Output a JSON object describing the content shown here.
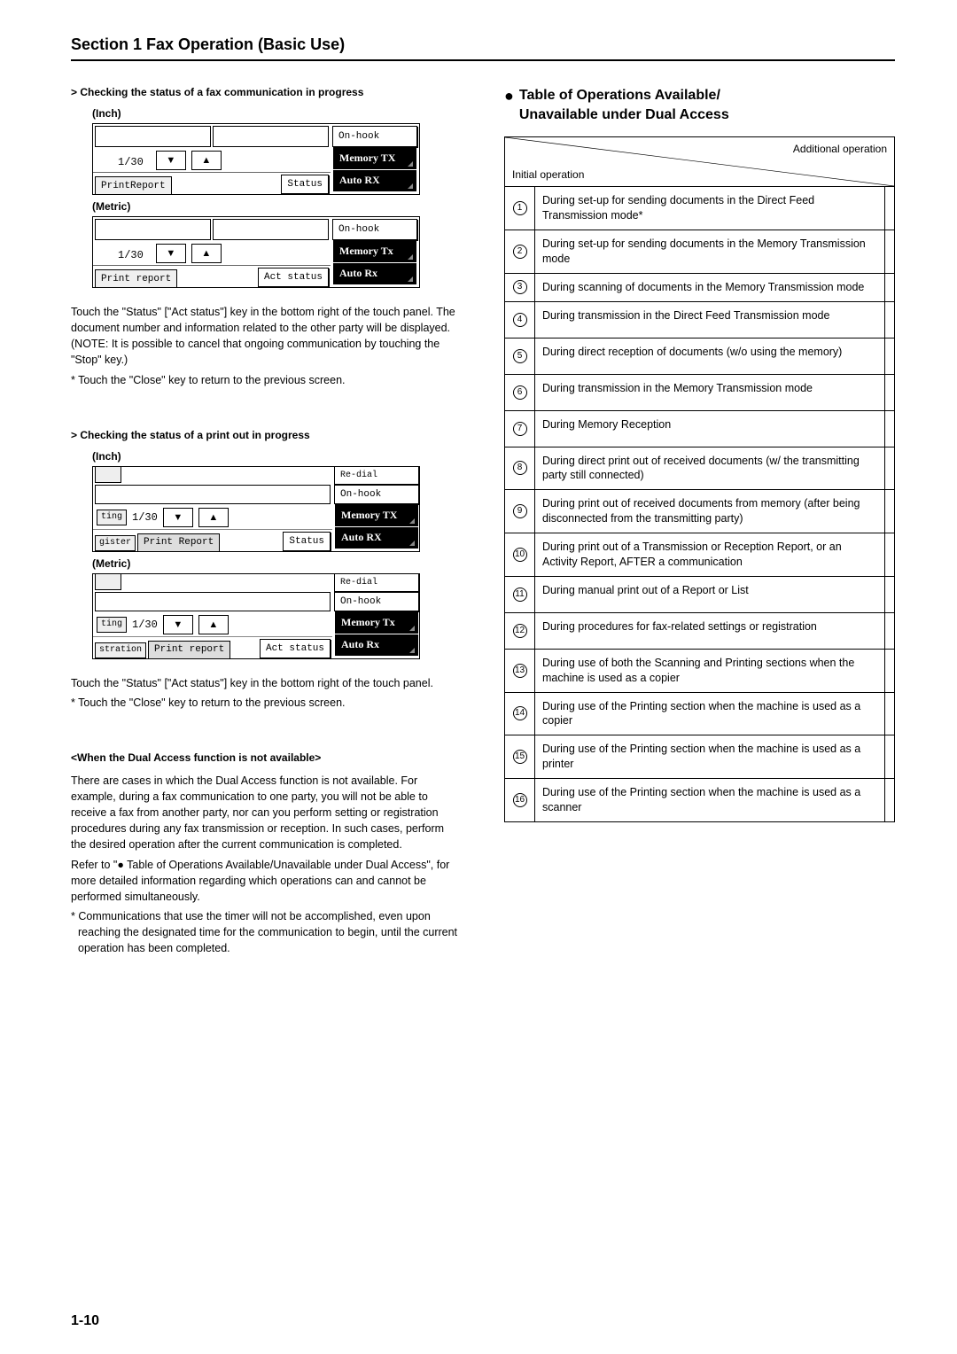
{
  "section_title": "Section 1  Fax Operation (Basic Use)",
  "page_number": "1-10",
  "left": {
    "h1": "> Checking the status of a fax communication in progress",
    "inch_label": "(Inch)",
    "metric_label": "(Metric)",
    "lcd1": {
      "frac": "1/30",
      "btn_onhook": "On-hook",
      "btn_memtx_i": "Memory TX",
      "btn_autorx_i": "Auto RX",
      "btn_memtx_m": "Memory Tx",
      "btn_autorx_m": "Auto Rx",
      "tab_print_i": "PrintReport",
      "tab_status_i": "Status",
      "tab_print_m": "Print report",
      "tab_status_m": "Act status"
    },
    "para1a": "Touch the \"Status\" [\"Act status\"] key in the bottom right of the touch panel. The document number and information related to the other party will be displayed. (NOTE: It is possible to cancel that ongoing communication by touching the \"Stop\" key.)",
    "para1b": "* Touch the \"Close\" key to return to the previous screen.",
    "h2": "> Checking the status of a print out in progress",
    "lcd2": {
      "frac": "1/30",
      "btn_redial": "Re-dial",
      "btn_onhook": "On-hook",
      "tab_ting": "ting",
      "tab_gister": "gister",
      "tab_printreport_i": "Print Report",
      "tab_status_i": "Status",
      "tab_stration": "stration",
      "tab_printreport_m": "Print report",
      "tab_status_m": "Act status"
    },
    "para2a": "Touch the \"Status\" [\"Act status\"] key in the bottom right of the touch panel.",
    "para2b": "* Touch the \"Close\" key to return to the previous screen.",
    "h3": "<When the Dual Access function is not available>",
    "para3a": "There are cases in which the Dual Access function is not available. For example, during a fax communication to one party, you will not be able to receive a fax from another party, nor can you perform setting or registration procedures during any fax transmission or reception. In such cases, perform the desired operation after the current communication is completed.",
    "para3b": "Refer to \"● Table of Operations Available/Unavailable under Dual Access\", for more detailed information regarding which operations can and cannot be performed simultaneously.",
    "para3c": "* Communications that use the timer will not be accomplished, even upon reaching the designated time for the communication to begin, until the current operation has been completed."
  },
  "right": {
    "heading_l1": "Table of Operations Available/",
    "heading_l2": "Unavailable under Dual Access",
    "additional_op": "Additional operation",
    "initial_op": "Initial operation",
    "rows": [
      "During set-up for sending documents in the Direct Feed Transmission mode*",
      "During set-up for sending documents in the Memory Transmission mode",
      "During scanning of documents in the Memory Transmission mode",
      "During transmission in the Direct Feed Transmission mode",
      "During direct reception of documents (w/o using the memory)",
      "During transmission in the Memory Transmission mode",
      "During Memory Reception",
      "During direct print out of received documents (w/ the transmitting party still connected)",
      "During print out of received documents from memory (after being disconnected from the transmitting party)",
      "During print out of a Transmission or Reception Report, or an Activity Report, AFTER a communication",
      "During manual print out of a Report or List",
      "During procedures for fax-related settings or registration",
      "During use of both the Scanning and Printing sections when the machine is used as a copier",
      "During use of the Printing section when the machine is used as a copier",
      "During use of the Printing section when the machine is used as a printer",
      "During use of the Printing section when the machine is used as a scanner"
    ],
    "nums": [
      "1",
      "2",
      "3",
      "4",
      "5",
      "6",
      "7",
      "8",
      "9",
      "10",
      "11",
      "12",
      "13",
      "14",
      "15",
      "16"
    ]
  }
}
